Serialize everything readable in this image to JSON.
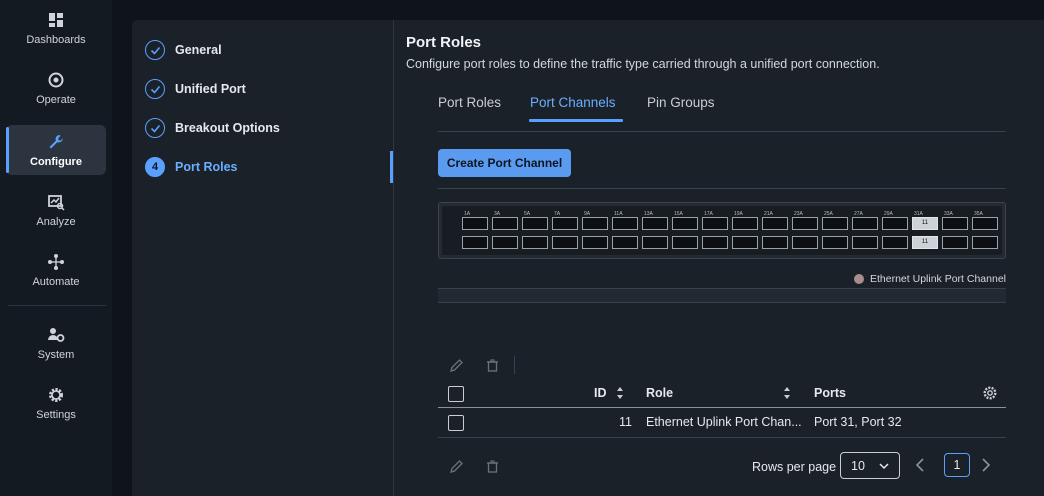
{
  "nav": {
    "items": [
      {
        "label": "Dashboards",
        "icon": "dashboard-icon"
      },
      {
        "label": "Operate",
        "icon": "operate-icon"
      },
      {
        "label": "Configure",
        "icon": "wrench-icon",
        "active": true
      },
      {
        "label": "Analyze",
        "icon": "analyze-icon"
      },
      {
        "label": "Automate",
        "icon": "automate-icon"
      },
      {
        "label": "System",
        "icon": "system-icon"
      },
      {
        "label": "Settings",
        "icon": "gear-icon"
      }
    ]
  },
  "steps": [
    {
      "label": "General",
      "state": "done"
    },
    {
      "label": "Unified Port",
      "state": "done"
    },
    {
      "label": "Breakout Options",
      "state": "done"
    },
    {
      "label": "Port Roles",
      "state": "current",
      "number": "4"
    }
  ],
  "page": {
    "title": "Port Roles",
    "subtitle": "Configure port roles to define the traffic type carried through a unified port connection."
  },
  "tabs": [
    {
      "label": "Port Roles"
    },
    {
      "label": "Port Channels",
      "active": true
    },
    {
      "label": "Pin Groups"
    }
  ],
  "create_button": "Create Port Channel",
  "switch": {
    "port_labels": [
      "1A",
      "3A",
      "5A",
      "7A",
      "9A",
      "11A",
      "13A",
      "15A",
      "17A",
      "19A",
      "21A",
      "23A",
      "25A",
      "27A",
      "29A",
      "31A",
      "33A",
      "35A"
    ],
    "selected_port_label": "11"
  },
  "legend": {
    "label": "Ethernet Uplink Port Channel",
    "color": "#a88d8f"
  },
  "table": {
    "columns": {
      "id": "ID",
      "role": "Role",
      "ports": "Ports"
    },
    "rows": [
      {
        "id": "11",
        "role": "Ethernet Uplink Port Chan...",
        "ports": "Port 31, Port 32"
      }
    ]
  },
  "pagination": {
    "rows_per_page_label": "Rows per page",
    "rows_per_page": "10",
    "current_page": "1"
  }
}
